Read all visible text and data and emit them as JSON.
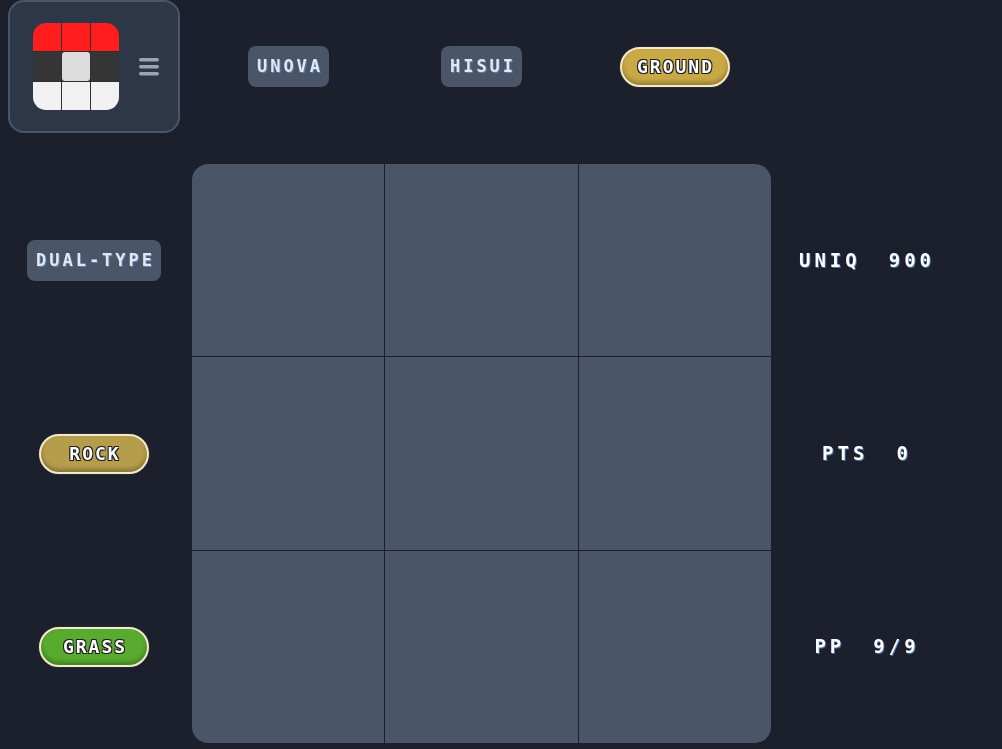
{
  "columns": [
    {
      "label": "UNOVA",
      "kind": "category"
    },
    {
      "label": "HISUI",
      "kind": "category"
    },
    {
      "label": "GROUND",
      "kind": "type",
      "color": "#c9a846"
    }
  ],
  "rows": [
    {
      "label": "DUAL-TYPE",
      "kind": "category"
    },
    {
      "label": "ROCK",
      "kind": "type",
      "color": "#b59d4c"
    },
    {
      "label": "GRASS",
      "kind": "type",
      "color": "#58ab2e"
    }
  ],
  "stats": [
    {
      "label": "UNIQ",
      "value": "900"
    },
    {
      "label": "PTS",
      "value": "0"
    },
    {
      "label": "PP",
      "value": "9/9"
    }
  ]
}
